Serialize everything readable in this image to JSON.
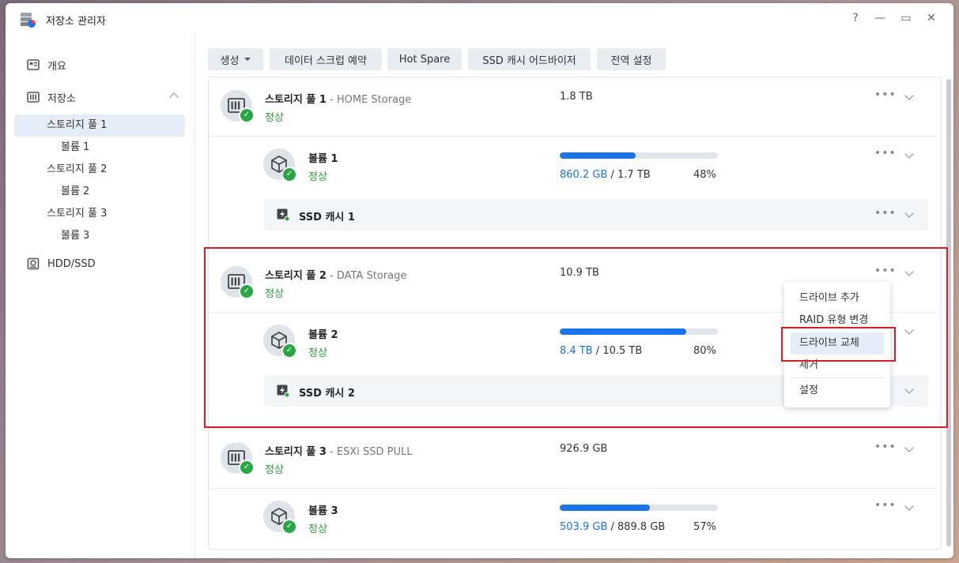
{
  "window": {
    "title": "저장소 관리자",
    "help": "?",
    "minimize": "—",
    "maximize": "▭",
    "close": "✕"
  },
  "sidebar": {
    "overview": "개요",
    "storage": "저장소",
    "pools": [
      {
        "label": "스토리지 풀 1",
        "volume": "볼륨 1"
      },
      {
        "label": "스토리지 풀 2",
        "volume": "볼륨 2"
      },
      {
        "label": "스토리지 풀 3",
        "volume": "볼륨 3"
      }
    ],
    "hdd": "HDD/SSD"
  },
  "toolbar": {
    "create": "생성",
    "scrub": "데이터 스크럽 예약",
    "hotspare": "Hot Spare",
    "ssd_advisor": "SSD 캐시 어드바이저",
    "global": "전역 설정"
  },
  "pools": [
    {
      "name": "스토리지 풀 1",
      "desc": " - HOME Storage",
      "status": "정상",
      "size": "1.8 TB",
      "volume": {
        "name": "볼륨 1",
        "status": "정상",
        "used": "860.2 GB",
        "total": " / 1.7 TB",
        "pct": "48%",
        "fraction": 0.48
      },
      "cache": "SSD 캐시 1"
    },
    {
      "name": "스토리지 풀 2",
      "desc": " - DATA Storage",
      "status": "정상",
      "size": "10.9 TB",
      "volume": {
        "name": "볼륨 2",
        "status": "정상",
        "used": "8.4 TB",
        "total": " / 10.5 TB",
        "pct": "80%",
        "fraction": 0.8
      },
      "cache": "SSD 캐시 2"
    },
    {
      "name": "스토리지 풀 3",
      "desc": " - ESXi SSD PULL",
      "status": "정상",
      "size": "926.9 GB",
      "volume": {
        "name": "볼륨 3",
        "status": "정상",
        "used": "503.9 GB",
        "total": " / 889.8 GB",
        "pct": "57%",
        "fraction": 0.57
      }
    }
  ],
  "context_menu": {
    "items": [
      "드라이브 추가",
      "RAID 유형 변경",
      "드라이브 교체",
      "제거",
      "설정"
    ],
    "highlighted": "드라이브 교체"
  },
  "colors": {
    "accent": "#1a73e8",
    "ok": "#27a844",
    "highlight_frame": "#d51f27"
  }
}
